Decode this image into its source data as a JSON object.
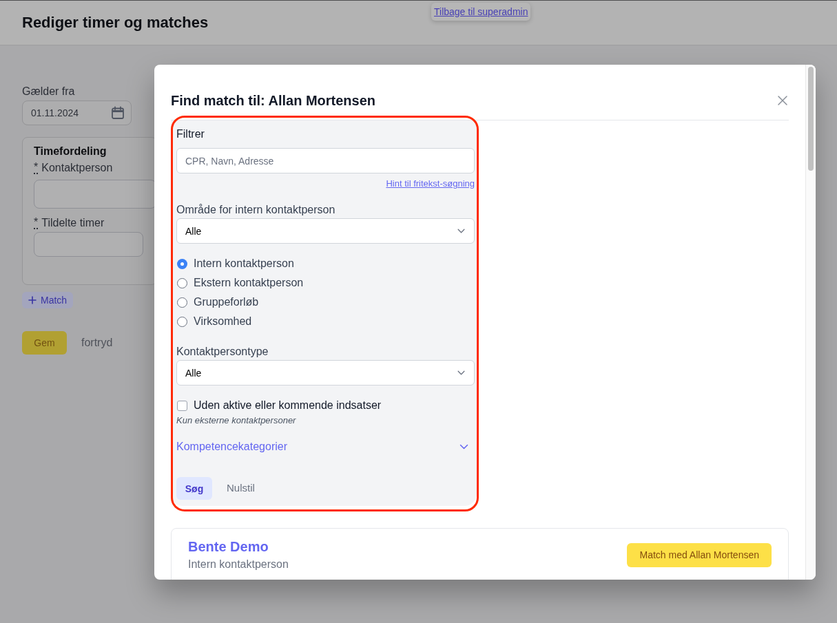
{
  "header": {
    "title": "Rediger timer og matches",
    "back_link": "Tilbage til superadmin"
  },
  "form": {
    "valid_from": {
      "label": "Gælder fra",
      "value": "01.11.2024"
    },
    "distribution": {
      "title": "Timefordeling",
      "fields": [
        {
          "required_mark": "*",
          "label": "Kontaktperson"
        },
        {
          "required_mark": "*",
          "label": "Tildelte timer"
        }
      ]
    },
    "add_match_button": "Match",
    "save_button": "Gem",
    "cancel_link": "fortryd"
  },
  "modal": {
    "title": "Find match til: Allan Mortensen",
    "filter": {
      "heading": "Filtrer",
      "search": {
        "placeholder": "CPR, Navn, Adresse"
      },
      "hint_link": "Hint til fritekst-søgning",
      "area_select": {
        "label": "Område for intern kontaktperson",
        "value": "Alle"
      },
      "contact_kinds": [
        {
          "label": "Intern kontaktperson",
          "selected": true
        },
        {
          "label": "Ekstern kontaktperson",
          "selected": false
        },
        {
          "label": "Gruppeforløb",
          "selected": false
        },
        {
          "label": "Virksomhed",
          "selected": false
        }
      ],
      "type_select": {
        "label": "Kontaktpersontype",
        "value": "Alle"
      },
      "no_active_filter": {
        "label": "Uden aktive eller kommende indsatser",
        "checked": false,
        "note": "Kun eksterne kontaktpersoner"
      },
      "competence_categories": {
        "label": "Kompetencekategorier",
        "expanded": false
      },
      "search_button": "Søg",
      "reset_button": "Nulstil"
    },
    "results": [
      {
        "name": "Bente Demo",
        "type": "Intern kontaktperson",
        "action": "Match med Allan Mortensen"
      }
    ]
  }
}
